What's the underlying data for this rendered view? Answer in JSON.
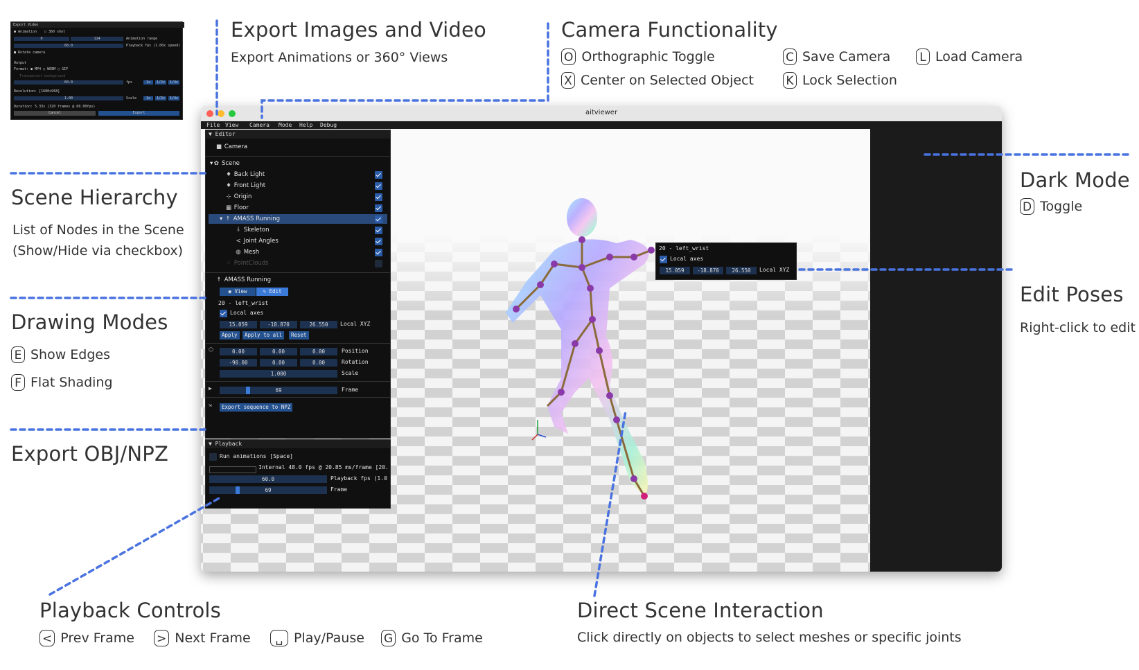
{
  "annotations": {
    "export": {
      "title": "Export Images and Video",
      "subtitle": "Export Animations or 360° Views"
    },
    "camera": {
      "title": "Camera Functionality",
      "shortcuts": [
        {
          "key": "O",
          "label": "Orthographic Toggle"
        },
        {
          "key": "C",
          "label": "Save Camera"
        },
        {
          "key": "L",
          "label": "Load Camera"
        },
        {
          "key": "X",
          "label": "Center on Selected Object"
        },
        {
          "key": "K",
          "label": "Lock Selection"
        }
      ]
    },
    "scene_hierarchy": {
      "title": "Scene Hierarchy",
      "line1": "List of Nodes in the Scene",
      "line2": "(Show/Hide via checkbox)"
    },
    "drawing_modes": {
      "title": "Drawing Modes",
      "shortcuts": [
        {
          "key": "E",
          "label": "Show Edges"
        },
        {
          "key": "F",
          "label": "Flat Shading"
        }
      ]
    },
    "export_obj": {
      "title": "Export OBJ/NPZ"
    },
    "dark_mode": {
      "title": "Dark Mode",
      "shortcut": {
        "key": "D",
        "label": "Toggle"
      }
    },
    "edit_poses": {
      "title": "Edit Poses",
      "subtitle": "Right-click to edit"
    },
    "playback": {
      "title": "Playback Controls",
      "shortcuts": [
        {
          "key": "<",
          "label": "Prev Frame"
        },
        {
          "key": ">",
          "label": "Next Frame"
        },
        {
          "key": "␣",
          "label": "Play/Pause"
        },
        {
          "key": "G",
          "label": "Go To Frame"
        }
      ]
    },
    "direct": {
      "title": "Direct Scene Interaction",
      "subtitle": "Click directly on objects to select meshes or specific joints"
    }
  },
  "export_dialog": {
    "title": "Export Video",
    "mode_options": [
      "Animation",
      "360 shot"
    ],
    "range_start": "0",
    "range_end": "114",
    "range_label": "Animation range",
    "fps_value": "60.0",
    "fps_label": "Playback fps (1.00x speed)",
    "rotate_label": "Rotate camera",
    "output_label": "Output",
    "format_label": "Format:",
    "formats": [
      "MP4",
      "WEBM",
      "GIF"
    ],
    "transparent_label": "Transparent background",
    "out_fps": "60.0",
    "out_fps_label": "fps",
    "speed_buttons": [
      "1x",
      "1/2x",
      "1/4x"
    ],
    "resolution_label": "Resolution: [1680x968]",
    "scale_value": "1.00",
    "scale_label": "Scale",
    "duration": "Duration: 5.33s (320 frames @ 60.00fps)",
    "cancel": "Cancel",
    "export": "Export"
  },
  "window": {
    "title": "aitviewer",
    "menu": [
      "File",
      "View",
      "Camera",
      "Mode",
      "Help",
      "Debug"
    ],
    "accent": "#2a5caa",
    "dark_pane_color": "#1b1b1b"
  },
  "editor": {
    "header": "Editor",
    "camera": "Camera",
    "scene": "Scene",
    "nodes": [
      {
        "label": "Back Light",
        "checked": true
      },
      {
        "label": "Front Light",
        "checked": true
      },
      {
        "label": "Origin",
        "checked": true
      },
      {
        "label": "Floor",
        "checked": true
      },
      {
        "label": "AMASS Running",
        "checked": true,
        "selected": true
      },
      {
        "label": "Skeleton",
        "checked": true
      },
      {
        "label": "Joint Angles",
        "checked": true
      },
      {
        "label": "Mesh",
        "checked": true
      },
      {
        "label": "PointClouds",
        "checked": false
      }
    ],
    "selected_name": "AMASS Running",
    "view_btn": "View",
    "edit_btn": "Edit",
    "joint": "20 - left_wrist",
    "local_axes": "Local axes",
    "xyz": [
      "15.059",
      "-18.870",
      "26.550"
    ],
    "xyz_label": "Local XYZ",
    "apply": "Apply",
    "apply_all": "Apply to all",
    "reset": "Reset",
    "position": [
      "0.00",
      "0.00",
      "0.00"
    ],
    "position_label": "Position",
    "rotation": [
      "-90.00",
      "0.00",
      "0.00"
    ],
    "rotation_label": "Rotation",
    "scale": "1.000",
    "scale_label": "Scale",
    "frame": "69",
    "frame_label": "Frame",
    "frame_fraction": 0.6,
    "export_npz": "Export sequence to NPZ"
  },
  "playback_panel": {
    "header": "Playback",
    "run": "Run animations [Space]",
    "internal": "Internal 48.0 fps @ 20.85 ms/frame [20.",
    "fps": "60.0",
    "fps_label": "Playback fps (1.0",
    "frame": "69",
    "frame_label": "Frame",
    "frame_fraction": 0.6
  },
  "popup": {
    "joint": "20 - left_wrist",
    "local_axes": "Local axes",
    "xyz": [
      "15.059",
      "-18.870",
      "26.550"
    ],
    "xyz_label": "Local XYZ"
  }
}
